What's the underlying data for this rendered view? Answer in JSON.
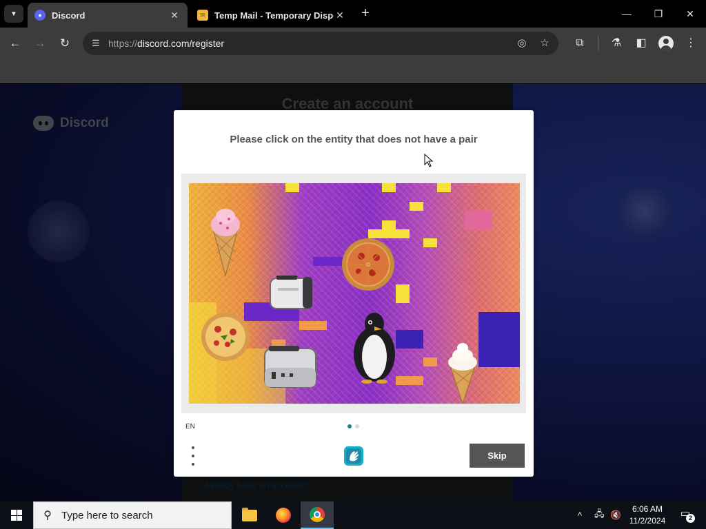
{
  "browser": {
    "tabs": [
      {
        "label": "Discord",
        "favicon": "discord-icon",
        "active": true
      },
      {
        "label": "Temp Mail - Temporary Dispo",
        "favicon": "temp-mail-icon",
        "active": false
      }
    ],
    "url_scheme": "https://",
    "url_host": "discord.com",
    "url_path": "/register"
  },
  "page": {
    "brand": "Discord",
    "form_title": "Create an account",
    "login_link": "Already have an account?"
  },
  "captcha": {
    "prompt": "Please click on the entity that does not have a pair",
    "language": "EN",
    "skip_label": "Skip",
    "progress": {
      "current": 1,
      "total": 2
    },
    "objects": [
      "ice-cream-cone",
      "ice-cream-cone",
      "pizza",
      "pizza",
      "toaster",
      "toaster",
      "penguin"
    ],
    "accent_color": "#1e7f80"
  },
  "taskbar": {
    "search_placeholder": "Type here to search",
    "time": "6:06 AM",
    "date": "11/2/2024",
    "notification_count": "2",
    "apps": [
      "file-explorer",
      "firefox",
      "chrome"
    ]
  },
  "colors": {
    "discord_blurple": "#5865f2",
    "skip_button": "#555555",
    "browser_chrome": "#3c3c3c"
  }
}
